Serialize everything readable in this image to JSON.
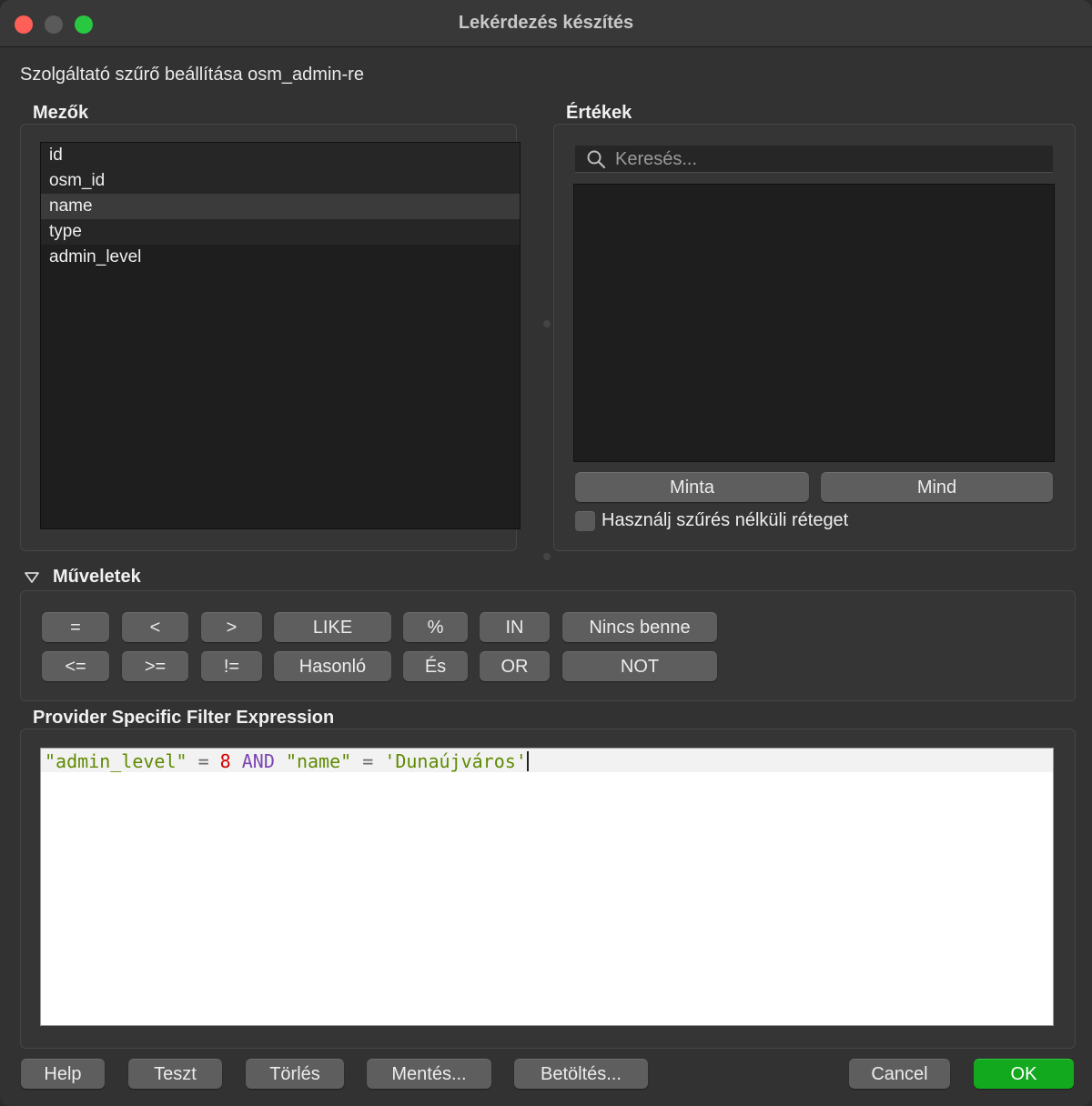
{
  "window": {
    "title": "Lekérdezés készítés",
    "subtitle": "Szolgáltató szűrő beállítása osm_admin-re"
  },
  "fields": {
    "label": "Mezők",
    "items": [
      "id",
      "osm_id",
      "name",
      "type",
      "admin_level"
    ],
    "selected": "name"
  },
  "values": {
    "label": "Értékek",
    "search_placeholder": "Keresés...",
    "sample_button": "Minta",
    "all_button": "Mind",
    "checkbox_label": "Használj szűrés nélküli réteget",
    "checkbox_checked": false
  },
  "operators": {
    "label": "Műveletek",
    "row1": [
      "=",
      "<",
      ">",
      "LIKE",
      "%",
      "IN",
      "Nincs benne"
    ],
    "row2": [
      "<=",
      ">=",
      "!=",
      "Hasonló",
      "És",
      "OR",
      "NOT"
    ]
  },
  "expression": {
    "label": "Provider Specific Filter Expression",
    "tokens": [
      {
        "text": "\"admin_level\"",
        "kind": "str"
      },
      {
        "text": " = ",
        "kind": "op"
      },
      {
        "text": "8",
        "kind": "num"
      },
      {
        "text": " AND ",
        "kind": "kw"
      },
      {
        "text": "\"name\"",
        "kind": "str"
      },
      {
        "text": " = ",
        "kind": "op"
      },
      {
        "text": "'Dunaújváros'",
        "kind": "str"
      }
    ]
  },
  "footer": {
    "help": "Help",
    "test": "Teszt",
    "clear": "Törlés",
    "save": "Mentés...",
    "load": "Betöltés...",
    "cancel": "Cancel",
    "ok": "OK"
  },
  "colors": {
    "ok_button": "#13a91f",
    "string_token": "#5f8a00",
    "number_token": "#d10000",
    "keyword_token": "#7a45b3"
  }
}
